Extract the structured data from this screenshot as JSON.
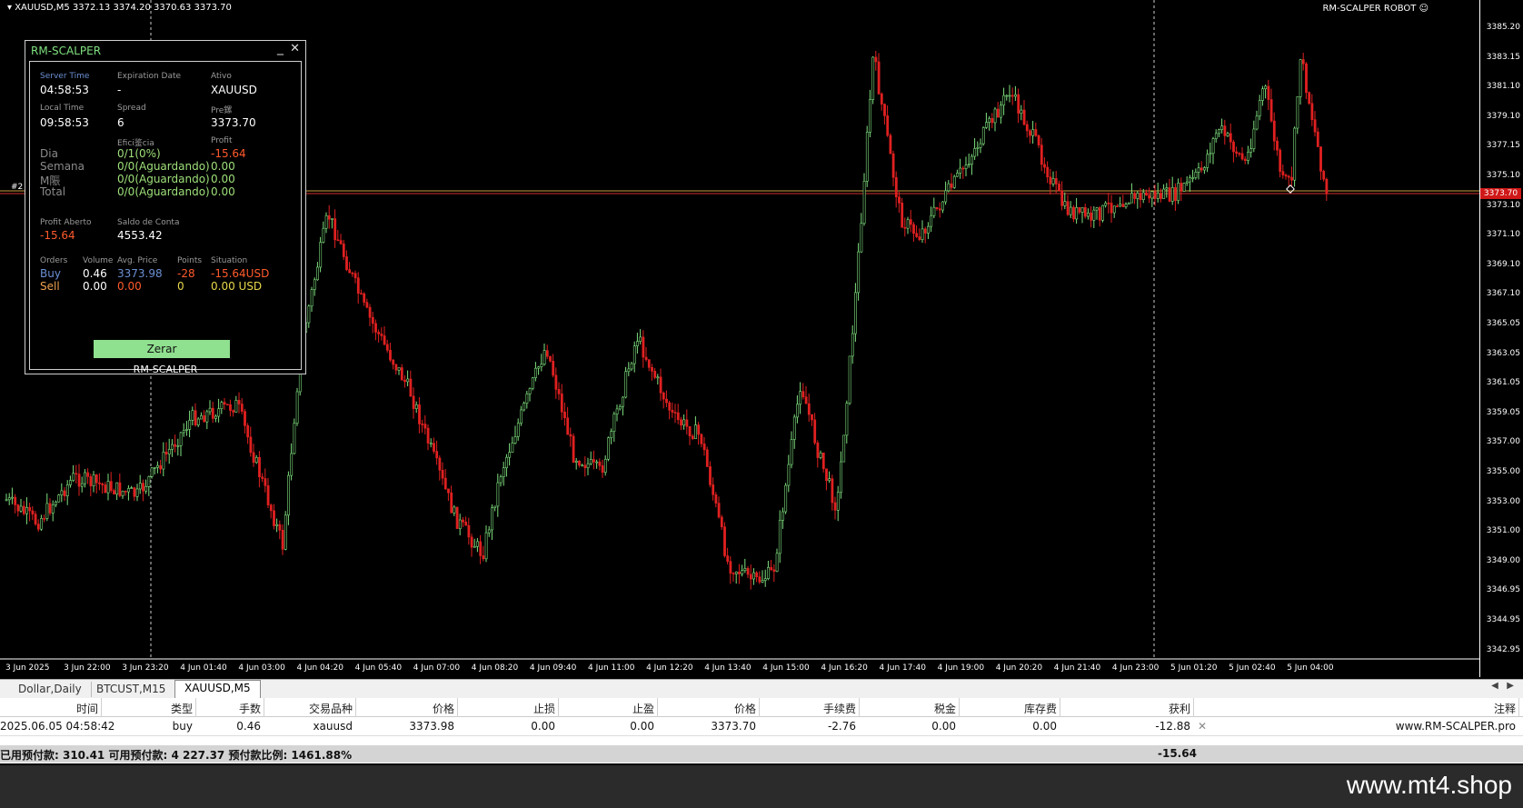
{
  "chart": {
    "header": "XAUUSD,M5  3372.13 3374.20 3370.63 3373.70",
    "robot_name": "RM-SCALPER ROBOT",
    "robot_icon": "smiley-icon",
    "current_price_tag": "3373.70",
    "trade_tag": "#2",
    "price_labels": [
      "3385.20",
      "3383.15",
      "3381.10",
      "3379.10",
      "3377.15",
      "3375.10",
      "3373.10",
      "3371.10",
      "3369.10",
      "3367.10",
      "3365.05",
      "3363.05",
      "3361.05",
      "3359.05",
      "3357.00",
      "3355.00",
      "3353.00",
      "3351.00",
      "3349.00",
      "3346.95",
      "3344.95",
      "3342.95"
    ],
    "time_labels": [
      "3 Jun 2025",
      "3 Jun 22:00",
      "3 Jun 23:20",
      "4 Jun 01:40",
      "4 Jun 03:00",
      "4 Jun 04:20",
      "4 Jun 05:40",
      "4 Jun 07:00",
      "4 Jun 08:20",
      "4 Jun 09:40",
      "4 Jun 11:00",
      "4 Jun 12:20",
      "4 Jun 13:40",
      "4 Jun 15:00",
      "4 Jun 16:20",
      "4 Jun 17:40",
      "4 Jun 19:00",
      "4 Jun 20:20",
      "4 Jun 21:40",
      "4 Jun 23:00",
      "5 Jun 01:20",
      "5 Jun 02:40",
      "5 Jun 04:00"
    ]
  },
  "panel": {
    "title": "RM-SCALPER",
    "server_time_label": "Server Time",
    "server_time": "04:58:53",
    "expiration_label": "Expiration Date",
    "expiration": "-",
    "ativo_label": "Ativo",
    "ativo": "XAUUSD",
    "local_time_label": "Local Time",
    "local_time": "09:58:53",
    "spread_label": "Spread",
    "spread": "6",
    "preco_label": "Pre鏍",
    "preco": "3373.70",
    "eficiencia_label": "Efici鉴cia",
    "profit_label": "Profit",
    "rows": [
      {
        "name": "Dia",
        "eff": "0/1(0%)",
        "profit": "-15.64"
      },
      {
        "name": "Semana",
        "eff": "0/0(Aguardando)",
        "profit": "0.00"
      },
      {
        "name": "M陙",
        "eff": "0/0(Aguardando)",
        "profit": "0.00"
      },
      {
        "name": "Total",
        "eff": "0/0(Aguardando)",
        "profit": "0.00"
      }
    ],
    "profit_aberto_label": "Profit Aberto",
    "profit_aberto": "-15.64",
    "saldo_label": "Saldo de Conta",
    "saldo": "4553.42",
    "orders_label": "Orders",
    "volume_label": "Volume",
    "avg_price_label": "Avg. Price",
    "points_label": "Points",
    "situation_label": "Situation",
    "buy": {
      "label": "Buy",
      "volume": "0.46",
      "avg": "3373.98",
      "points": "-28",
      "situation": "-15.64USD"
    },
    "sell": {
      "label": "Sell",
      "volume": "0.00",
      "avg": "0.00",
      "points": "0",
      "situation": "0.00 USD"
    },
    "zerar_label": "Zerar",
    "footer": "RM-SCALPER"
  },
  "tabs": [
    "Dollar,Daily",
    "BTCUST,M15",
    "XAUUSD,M5"
  ],
  "table": {
    "headers": [
      "时间",
      "类型",
      "手数",
      "交易品种",
      "价格",
      "止损",
      "止盈",
      "价格",
      "手续费",
      "税金",
      "库存费",
      "获利",
      "注释"
    ],
    "row": [
      "2025.06.05 04:58:42",
      "buy",
      "0.46",
      "xauusd",
      "3373.98",
      "0.00",
      "0.00",
      "3373.70",
      "-2.76",
      "0.00",
      "0.00",
      "-12.88",
      "www.RM-SCALPER.pro"
    ],
    "summary": "已用预付款: 310.41   可用预付款: 4 227.37   预付款比例: 1461.88%",
    "summary_profit": "-15.64"
  },
  "watermark": "www.mt4.shop"
}
